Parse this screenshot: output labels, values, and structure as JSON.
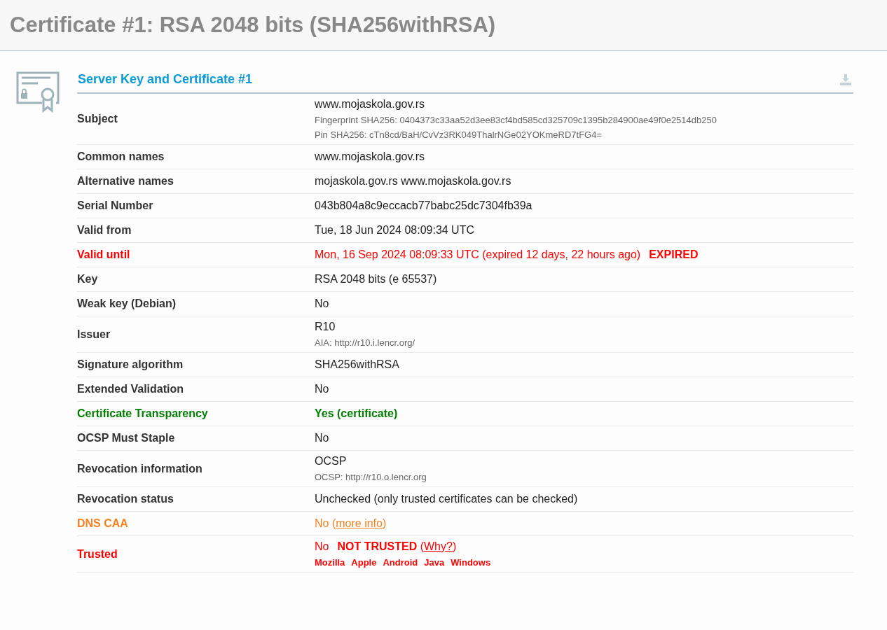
{
  "page_title": "Certificate #1: RSA 2048 bits (SHA256withRSA)",
  "section": {
    "title": "Server Key and Certificate #1",
    "rows": [
      {
        "label": "Subject",
        "color": "#333333",
        "parts": [
          {
            "kind": "text",
            "text": "www.mojaskola.gov.rs"
          }
        ],
        "details": [
          "Fingerprint SHA256: 0404373c33aa52d3ee83cf4bd585cd325709c1395b284900ae49f0e2514db250",
          "Pin SHA256: cTn8cd/BaH/CvVz3RK049ThalrNGe02YOKmeRD7tFG4="
        ]
      },
      {
        "label": "Common names",
        "color": "#333333",
        "parts": [
          {
            "kind": "text",
            "text": "www.mojaskola.gov.rs"
          }
        ]
      },
      {
        "label": "Alternative names",
        "color": "#333333",
        "parts": [
          {
            "kind": "text",
            "text": "mojaskola.gov.rs www.mojaskola.gov.rs"
          }
        ]
      },
      {
        "label": "Serial Number",
        "color": "#333333",
        "parts": [
          {
            "kind": "text",
            "text": "043b804a8c9eccacb77babc25dc7304fb39a"
          }
        ]
      },
      {
        "label": "Valid from",
        "color": "#333333",
        "parts": [
          {
            "kind": "text",
            "text": "Tue, 18 Jun 2024 08:09:34 UTC"
          }
        ]
      },
      {
        "label": "Valid until",
        "color": "#ff0000",
        "parts": [
          {
            "kind": "text",
            "text": "Mon, 16 Sep 2024 08:09:33 UTC (expired 12 days, 22 hours ago)"
          },
          {
            "kind": "badge",
            "text": "EXPIRED"
          }
        ]
      },
      {
        "label": "Key",
        "color": "#333333",
        "parts": [
          {
            "kind": "text",
            "text": "RSA 2048 bits (e 65537)"
          }
        ]
      },
      {
        "label": "Weak key (Debian)",
        "color": "#333333",
        "parts": [
          {
            "kind": "text",
            "text": "No"
          }
        ]
      },
      {
        "label": "Issuer",
        "color": "#333333",
        "parts": [
          {
            "kind": "text",
            "text": "R10"
          }
        ],
        "details": [
          "AIA: http://r10.i.lencr.org/"
        ]
      },
      {
        "label": "Signature algorithm",
        "color": "#333333",
        "parts": [
          {
            "kind": "text",
            "text": "SHA256withRSA"
          }
        ]
      },
      {
        "label": "Extended Validation",
        "color": "#333333",
        "parts": [
          {
            "kind": "text",
            "text": "No"
          }
        ]
      },
      {
        "label": "Certificate Transparency",
        "color": "#008000",
        "parts": [
          {
            "kind": "strong",
            "text": "Yes (certificate)"
          }
        ]
      },
      {
        "label": "OCSP Must Staple",
        "color": "#333333",
        "parts": [
          {
            "kind": "text",
            "text": "No"
          }
        ]
      },
      {
        "label": "Revocation information",
        "color": "#333333",
        "parts": [
          {
            "kind": "text",
            "text": "OCSP"
          }
        ],
        "details": [
          "OCSP: http://r10.o.lencr.org"
        ]
      },
      {
        "label": "Revocation status",
        "color": "#333333",
        "parts": [
          {
            "kind": "text",
            "text": "Unchecked (only trusted certificates can be checked)"
          }
        ]
      },
      {
        "label": "DNS CAA",
        "color": "#f5821f",
        "parts": [
          {
            "kind": "text",
            "text": "No ("
          },
          {
            "kind": "link",
            "text": "more info"
          },
          {
            "kind": "text",
            "text": ")"
          }
        ]
      },
      {
        "label": "Trusted",
        "color": "#ff0000",
        "parts": [
          {
            "kind": "text",
            "text": "No"
          },
          {
            "kind": "badge",
            "text": "NOT TRUSTED"
          },
          {
            "kind": "text",
            "text": " ("
          },
          {
            "kind": "link",
            "text": "Why?"
          },
          {
            "kind": "text",
            "text": ")"
          }
        ],
        "tags": [
          "Mozilla",
          "Apple",
          "Android",
          "Java",
          "Windows"
        ]
      }
    ]
  }
}
